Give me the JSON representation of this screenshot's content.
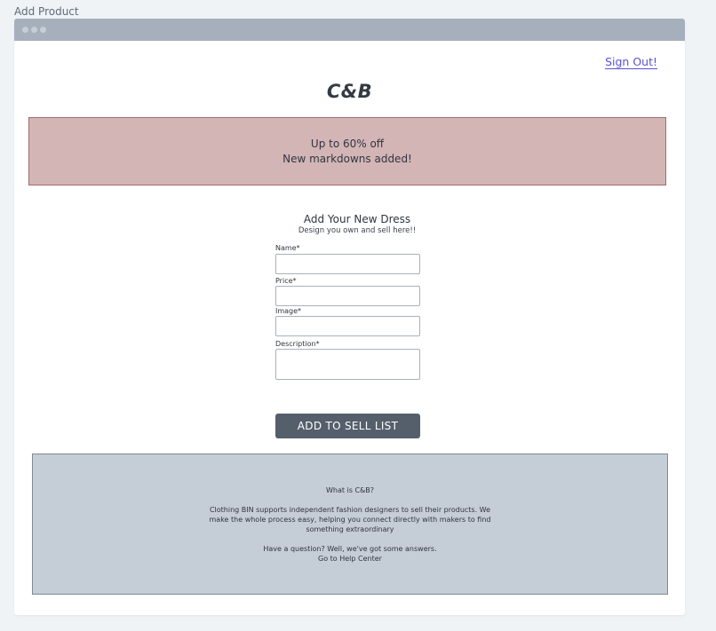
{
  "page": {
    "title": "Add Product"
  },
  "header": {
    "brand": "C&B",
    "sign_out": "Sign Out!"
  },
  "promo": {
    "line1": "Up to 60% off",
    "line2": "New markdowns added!"
  },
  "form": {
    "title": "Add Your New Dress",
    "subtitle": "Design you own and sell here!!",
    "fields": [
      {
        "label": "Name*",
        "value": "",
        "placeholder": ""
      },
      {
        "label": "Price*",
        "value": "",
        "placeholder": ""
      },
      {
        "label": "Image*",
        "value": "",
        "placeholder": ""
      },
      {
        "label": "Description*",
        "value": "",
        "placeholder": ""
      }
    ],
    "submit_label": "ADD TO SELL LIST"
  },
  "footer": {
    "heading": "What is C&B?",
    "about": "Clothing BIN supports independent fashion designers to sell their products. We make the whole process easy, helping you connect directly with makers to find something extraordinary",
    "question": "Have a question? Well, we've got some answers.",
    "help_link": "Go to Help Center"
  },
  "colors": {
    "titlebar": "#a6b0bc",
    "promo_bg": "#d3b5b5",
    "promo_border": "#a46a6c",
    "button_bg": "#555f6b",
    "footer_bg": "#c5cdd7",
    "link": "#5b4fd6"
  }
}
